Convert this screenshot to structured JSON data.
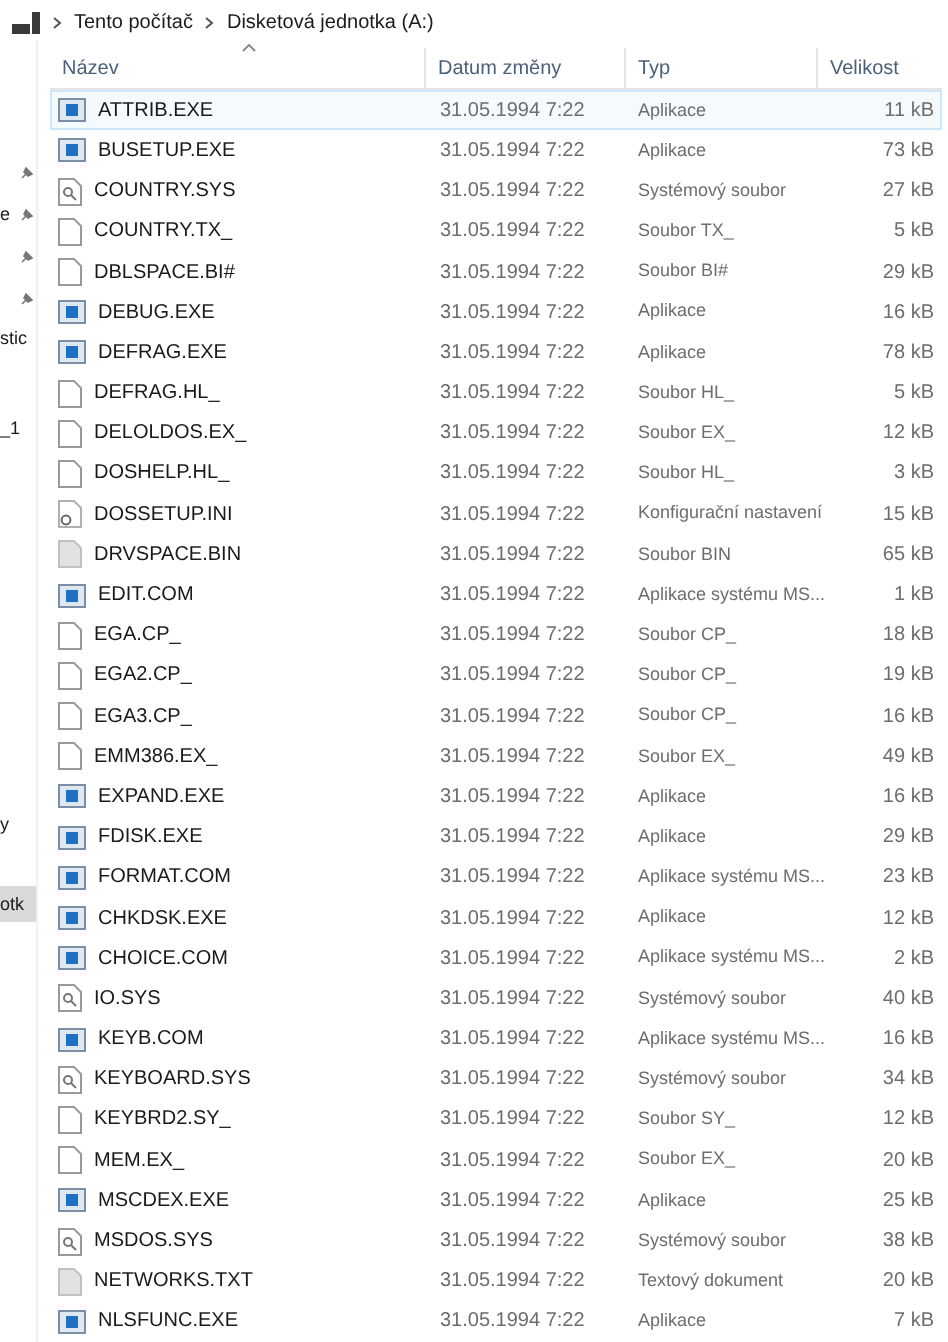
{
  "breadcrumb": [
    "Tento počítač",
    "Disketová jednotka (A:)"
  ],
  "sidebar": {
    "items": [
      {
        "pinned": true,
        "selected": false
      },
      {
        "label": "e",
        "pinned": true,
        "selected": false
      },
      {
        "pinned": true,
        "selected": false
      },
      {
        "pinned": true,
        "selected": false
      },
      {
        "label": "stic",
        "pinned": false,
        "selected": false
      },
      {
        "label": "_1",
        "pinned": false,
        "selected": false
      },
      {
        "label": "y",
        "pinned": false,
        "selected": false
      },
      {
        "label": "otk",
        "pinned": false,
        "selected": true
      }
    ]
  },
  "table": {
    "columns": [
      "Název",
      "Datum změny",
      "Typ",
      "Velikost"
    ],
    "rows": [
      {
        "name": "ATTRIB.EXE",
        "date": "31.05.1994 7:22",
        "type": "Aplikace",
        "size": "11 kB",
        "kind": "app",
        "selected": true
      },
      {
        "name": "BUSETUP.EXE",
        "date": "31.05.1994 7:22",
        "type": "Aplikace",
        "size": "73 kB",
        "kind": "app",
        "selected": false
      },
      {
        "name": "COUNTRY.SYS",
        "date": "31.05.1994 7:22",
        "type": "Systémový soubor",
        "size": "27 kB",
        "kind": "system",
        "selected": false
      },
      {
        "name": "COUNTRY.TX_",
        "date": "31.05.1994 7:22",
        "type": "Soubor TX_",
        "size": "5 kB",
        "kind": "file",
        "selected": false
      },
      {
        "name": "DBLSPACE.BI#",
        "date": "31.05.1994 7:22",
        "type": "Soubor BI#",
        "size": "29 kB",
        "kind": "file",
        "selected": false
      },
      {
        "name": "DEBUG.EXE",
        "date": "31.05.1994 7:22",
        "type": "Aplikace",
        "size": "16 kB",
        "kind": "app",
        "selected": false
      },
      {
        "name": "DEFRAG.EXE",
        "date": "31.05.1994 7:22",
        "type": "Aplikace",
        "size": "78 kB",
        "kind": "app",
        "selected": false
      },
      {
        "name": "DEFRAG.HL_",
        "date": "31.05.1994 7:22",
        "type": "Soubor HL_",
        "size": "5 kB",
        "kind": "file",
        "selected": false
      },
      {
        "name": "DELOLDOS.EX_",
        "date": "31.05.1994 7:22",
        "type": "Soubor EX_",
        "size": "12 kB",
        "kind": "file",
        "selected": false
      },
      {
        "name": "DOSHELP.HL_",
        "date": "31.05.1994 7:22",
        "type": "Soubor HL_",
        "size": "3 kB",
        "kind": "file",
        "selected": false
      },
      {
        "name": "DOSSETUP.INI",
        "date": "31.05.1994 7:22",
        "type": "Konfigurační nastavení",
        "size": "15 kB",
        "kind": "config",
        "selected": false
      },
      {
        "name": "DRVSPACE.BIN",
        "date": "31.05.1994 7:22",
        "type": "Soubor BIN",
        "size": "65 kB",
        "kind": "binary",
        "selected": false
      },
      {
        "name": "EDIT.COM",
        "date": "31.05.1994 7:22",
        "type": "Aplikace systému MS...",
        "size": "1 kB",
        "kind": "app",
        "selected": false
      },
      {
        "name": "EGA.CP_",
        "date": "31.05.1994 7:22",
        "type": "Soubor CP_",
        "size": "18 kB",
        "kind": "file",
        "selected": false
      },
      {
        "name": "EGA2.CP_",
        "date": "31.05.1994 7:22",
        "type": "Soubor CP_",
        "size": "19 kB",
        "kind": "file",
        "selected": false
      },
      {
        "name": "EGA3.CP_",
        "date": "31.05.1994 7:22",
        "type": "Soubor CP_",
        "size": "16 kB",
        "kind": "file",
        "selected": false
      },
      {
        "name": "EMM386.EX_",
        "date": "31.05.1994 7:22",
        "type": "Soubor EX_",
        "size": "49 kB",
        "kind": "file",
        "selected": false
      },
      {
        "name": "EXPAND.EXE",
        "date": "31.05.1994 7:22",
        "type": "Aplikace",
        "size": "16 kB",
        "kind": "app",
        "selected": false
      },
      {
        "name": "FDISK.EXE",
        "date": "31.05.1994 7:22",
        "type": "Aplikace",
        "size": "29 kB",
        "kind": "app",
        "selected": false
      },
      {
        "name": "FORMAT.COM",
        "date": "31.05.1994 7:22",
        "type": "Aplikace systému MS...",
        "size": "23 kB",
        "kind": "app",
        "selected": false
      },
      {
        "name": "CHKDSK.EXE",
        "date": "31.05.1994 7:22",
        "type": "Aplikace",
        "size": "12 kB",
        "kind": "app",
        "selected": false
      },
      {
        "name": "CHOICE.COM",
        "date": "31.05.1994 7:22",
        "type": "Aplikace systému MS...",
        "size": "2 kB",
        "kind": "app",
        "selected": false
      },
      {
        "name": "IO.SYS",
        "date": "31.05.1994 7:22",
        "type": "Systémový soubor",
        "size": "40 kB",
        "kind": "system",
        "selected": false
      },
      {
        "name": "KEYB.COM",
        "date": "31.05.1994 7:22",
        "type": "Aplikace systému MS...",
        "size": "16 kB",
        "kind": "app",
        "selected": false
      },
      {
        "name": "KEYBOARD.SYS",
        "date": "31.05.1994 7:22",
        "type": "Systémový soubor",
        "size": "34 kB",
        "kind": "system",
        "selected": false
      },
      {
        "name": "KEYBRD2.SY_",
        "date": "31.05.1994 7:22",
        "type": "Soubor SY_",
        "size": "12 kB",
        "kind": "file",
        "selected": false
      },
      {
        "name": "MEM.EX_",
        "date": "31.05.1994 7:22",
        "type": "Soubor EX_",
        "size": "20 kB",
        "kind": "file",
        "selected": false
      },
      {
        "name": "MSCDEX.EXE",
        "date": "31.05.1994 7:22",
        "type": "Aplikace",
        "size": "25 kB",
        "kind": "app",
        "selected": false
      },
      {
        "name": "MSDOS.SYS",
        "date": "31.05.1994 7:22",
        "type": "Systémový soubor",
        "size": "38 kB",
        "kind": "system",
        "selected": false
      },
      {
        "name": "NETWORKS.TXT",
        "date": "31.05.1994 7:22",
        "type": "Textový dokument",
        "size": "20 kB",
        "kind": "binary",
        "selected": false
      },
      {
        "name": "NLSFUNC.EXE",
        "date": "31.05.1994 7:22",
        "type": "Aplikace",
        "size": "7 kB",
        "kind": "app",
        "selected": false
      }
    ]
  }
}
